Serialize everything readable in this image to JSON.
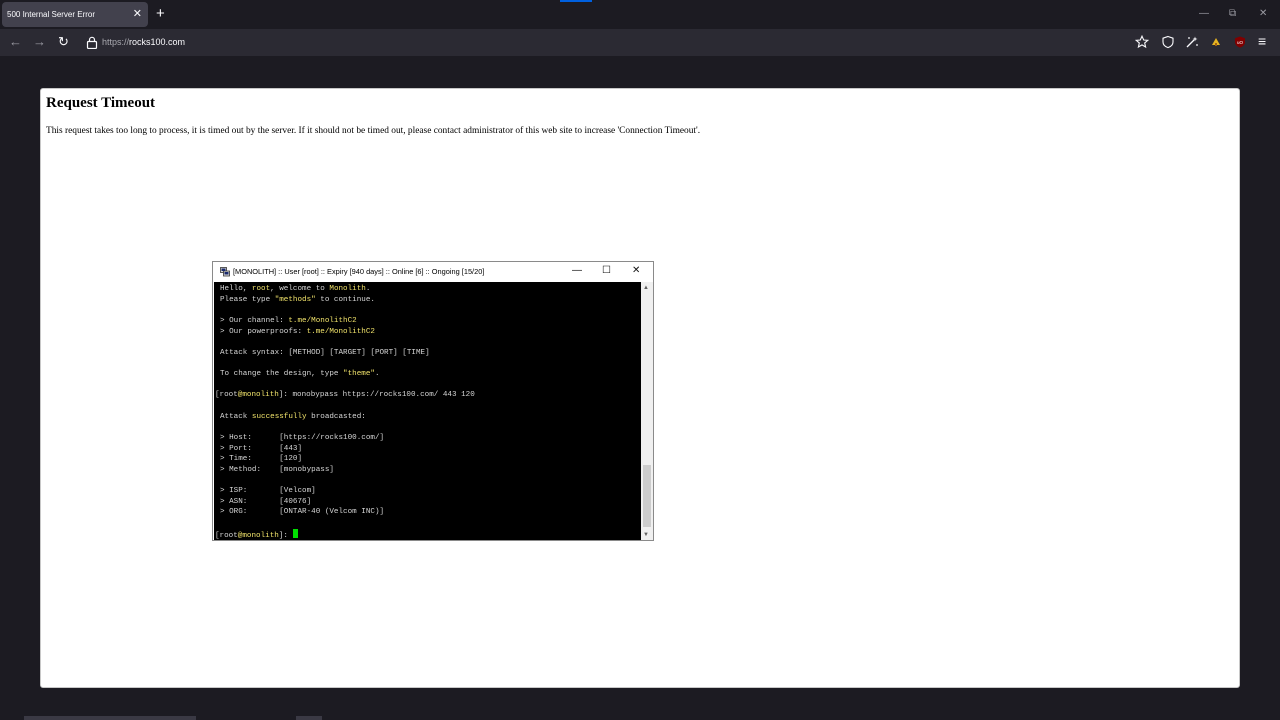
{
  "browser": {
    "tab_title": "500 Internal Server Error",
    "tab_close": "✕",
    "new_tab": "+",
    "window_controls": {
      "minimize": "—",
      "restore": "⧉",
      "close": "✕"
    },
    "nav": {
      "back": "←",
      "forward": "→",
      "reload": "↻"
    },
    "url_scheme": "https://",
    "url_host": "rocks100.com",
    "toolbar_icons": [
      "bookmark-star-icon",
      "shield-icon",
      "extension-wand-icon",
      "extension-yellow-icon",
      "ublock-icon",
      "menu-icon"
    ],
    "menu": "≡"
  },
  "page": {
    "title": "Request Timeout",
    "message": "This request takes too long to process, it is timed out by the server. If it should not be timed out, please contact administrator of this web site to increase 'Connection Timeout'."
  },
  "terminal": {
    "title": "[MONOLITH] :: User [root] :: Expiry [940 days] :: Online [6] :: Ongoing [15/20]",
    "controls": {
      "minimize": "—",
      "maximize": "☐",
      "close": "✕"
    },
    "lines": {
      "l1a": "Hello, ",
      "l1b": "root",
      "l1c": ", welcome to ",
      "l1d": "Monolith",
      "l1e": ".",
      "l2a": "Please type ",
      "l2b": "\"methods\"",
      "l2c": " to continue.",
      "l4a": "> Our channel: ",
      "l4b": "t.me/MonolithC2",
      "l5a": "> Our powerproofs: ",
      "l5b": "t.me/MonolithC2",
      "l7a": "Attack syntax: ",
      "l7b": "[METHOD] [TARGET] [PORT] [TIME]",
      "l9a": "To change the design, type ",
      "l9b": "\"theme\"",
      "l9c": ".",
      "l11a": "[root",
      "l11b": "@monolith",
      "l11c": "]",
      "l11d": ": monobypass https://rocks100.com/ 443 120",
      "l13a": "Attack ",
      "l13b": "successfully",
      "l13c": " broadcasted:",
      "l15a": "> Host:      ",
      "l15b": "[https://rocks100.com/]",
      "l16a": "> Port:      ",
      "l16b": "[443]",
      "l17a": "> Time:      ",
      "l17b": "[120]",
      "l18a": "> Method:    ",
      "l18b": "[monobypass]",
      "l20a": "> ISP:       ",
      "l20b": "[Velcom]",
      "l21a": "> ASN:       ",
      "l21b": "[40676]",
      "l22a": "> ORG:       ",
      "l22b": "[ONTAR-40 (Velcom INC)]",
      "l24a": "[root",
      "l24b": "@monolith",
      "l24c": "]",
      "l24d": ": "
    }
  },
  "colors": {
    "accent_yellow": "#f2e46b",
    "cursor_green": "#00e000",
    "chrome_bg": "#1c1b22",
    "toolbar_bg": "#2b2a33"
  }
}
